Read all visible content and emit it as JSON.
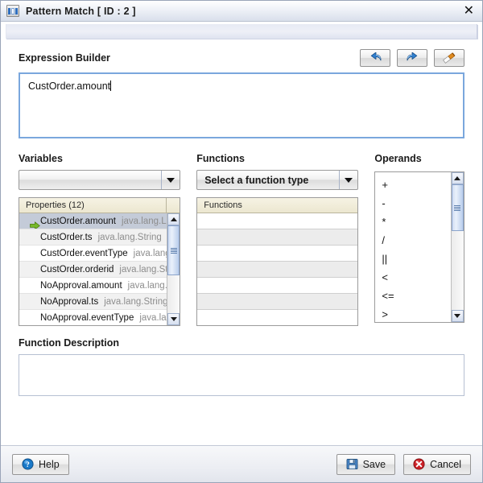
{
  "window": {
    "title": "Pattern Match [ ID : 2 ]",
    "icon": "window-icon",
    "close_label": "✕"
  },
  "expression_builder": {
    "label": "Expression Builder",
    "value": "CustOrder.amount",
    "placeholder": "",
    "toolbar": [
      {
        "name": "undo-button",
        "icon": "undo-icon",
        "tooltip": "Undo"
      },
      {
        "name": "redo-button",
        "icon": "redo-icon",
        "tooltip": "Redo"
      },
      {
        "name": "erase-button",
        "icon": "eraser-icon",
        "tooltip": "Erase"
      }
    ]
  },
  "variables": {
    "label": "Variables",
    "dropdown_value": "",
    "dropdown_placeholder": "",
    "table_header": "Properties (12)",
    "rows": [
      {
        "name": "CustOrder.amount",
        "type": "java.lang.Lo",
        "selected": true
      },
      {
        "name": "CustOrder.ts",
        "type": "java.lang.String",
        "selected": false
      },
      {
        "name": "CustOrder.eventType",
        "type": "java.lang",
        "selected": false
      },
      {
        "name": "CustOrder.orderid",
        "type": "java.lang.Str",
        "selected": false
      },
      {
        "name": "NoApproval.amount",
        "type": "java.lang.L",
        "selected": false
      },
      {
        "name": "NoApproval.ts",
        "type": "java.lang.String",
        "selected": false
      },
      {
        "name": "NoApproval.eventType",
        "type": "java.lan",
        "selected": false
      }
    ]
  },
  "functions": {
    "label": "Functions",
    "dropdown_value": "Select a function type",
    "table_header": "Functions",
    "rows": [
      "",
      "",
      "",
      "",
      "",
      "",
      ""
    ]
  },
  "operands": {
    "label": "Operands",
    "items": [
      "+",
      "-",
      "*",
      "/",
      "||",
      "<",
      "<=",
      ">"
    ]
  },
  "function_description": {
    "label": "Function Description",
    "value": ""
  },
  "footer": {
    "help_label": "Help",
    "save_label": "Save",
    "cancel_label": "Cancel"
  },
  "colors": {
    "focus_border": "#7aa7dd",
    "selected_row": "#c4cbd8",
    "header_beige": "#ece7d0",
    "green_arrow": "#6aa521",
    "cancel_red": "#cc2026",
    "help_blue": "#1a79c8"
  }
}
